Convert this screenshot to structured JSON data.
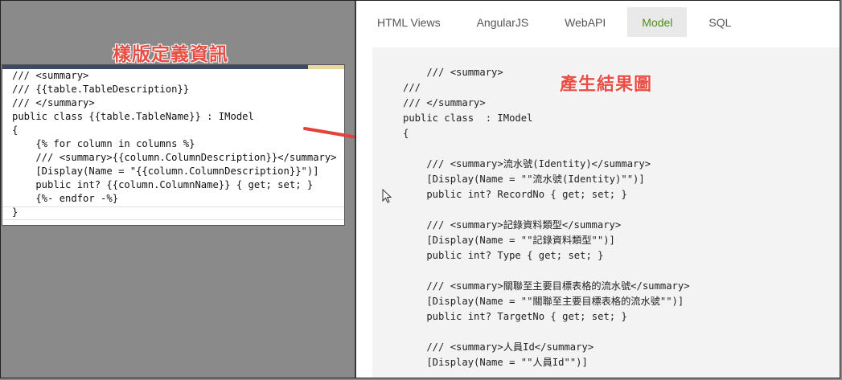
{
  "labels": {
    "template_title": "樣版定義資訊",
    "result_title": "產生結果圖"
  },
  "colors": {
    "annotation": "#e84e45",
    "active_tab": "#4d8a1e",
    "arrow": "#e5403a"
  },
  "template": {
    "lines": [
      "/// <summary>",
      "/// {{table.TableDescription}}",
      "/// </summary>",
      "public class {{table.TableName}} : IModel",
      "{",
      "    {% for column in columns %}",
      "    /// <summary>{{column.ColumnDescription}}</summary>",
      "    [Display(Name = \"{{column.ColumnDescription}}\")]",
      "    public int? {{column.ColumnName}} { get; set; }",
      "    {%- endfor -%}",
      "}"
    ]
  },
  "tabs": [
    {
      "label": "HTML Views",
      "active": false
    },
    {
      "label": "AngularJS",
      "active": false
    },
    {
      "label": "WebAPI",
      "active": false
    },
    {
      "label": "Model",
      "active": true
    },
    {
      "label": "SQL",
      "active": false
    }
  ],
  "output": {
    "lines": [
      "    /// <summary>",
      "///",
      "/// </summary>",
      "public class  : IModel",
      "{",
      "",
      "    /// <summary>流水號(Identity)</summary>",
      "    [Display(Name = \"\"流水號(Identity)\"\")]",
      "    public int? RecordNo { get; set; }",
      "",
      "    /// <summary>記錄資料類型</summary>",
      "    [Display(Name = \"\"記錄資料類型\"\")]",
      "    public int? Type { get; set; }",
      "",
      "    /// <summary>關聯至主要目標表格的流水號</summary>",
      "    [Display(Name = \"\"關聯至主要目標表格的流水號\"\")]",
      "    public int? TargetNo { get; set; }",
      "",
      "    /// <summary>人員Id</summary>",
      "    [Display(Name = \"\"人員Id\"\")]"
    ]
  }
}
